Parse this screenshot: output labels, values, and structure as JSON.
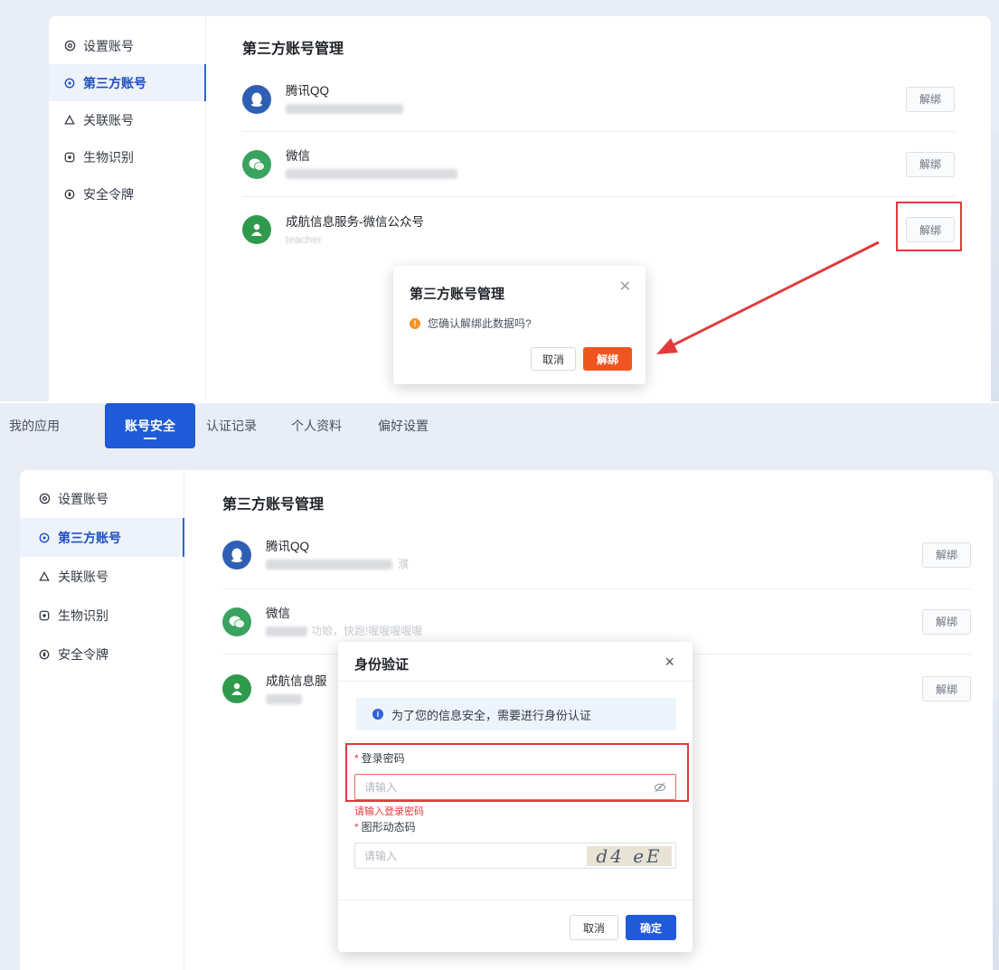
{
  "sidebar": {
    "items": [
      {
        "label": "设置账号",
        "icon": "gear-icon"
      },
      {
        "label": "第三方账号",
        "icon": "shield-icon",
        "active": true
      },
      {
        "label": "关联账号",
        "icon": "link-icon"
      },
      {
        "label": "生物识别",
        "icon": "face-scan-icon"
      },
      {
        "label": "安全令牌",
        "icon": "token-icon"
      }
    ]
  },
  "section_title": "第三方账号管理",
  "accounts": [
    {
      "name": "腾讯QQ",
      "icon": "qq-icon"
    },
    {
      "name": "微信",
      "icon": "wechat-icon"
    },
    {
      "name": "成航信息服务-微信公众号",
      "short_name": "成航信息服",
      "sub": "teacher",
      "icon": "user-icon"
    }
  ],
  "bottom_subs": {
    "qq_tail": "濮",
    "wx_tail": "功娘，快跑!喔喔喔喔喔"
  },
  "unbind_label": "解绑",
  "confirm_dialog": {
    "title": "第三方账号管理",
    "message": "您确认解绑此数据吗?",
    "cancel": "取消",
    "ok": "解绑"
  },
  "tabs": [
    "我的应用",
    "账号安全",
    "认证记录",
    "个人资料",
    "偏好设置"
  ],
  "auth_dialog": {
    "title": "身份验证",
    "tip": "为了您的信息安全，需要进行身份认证",
    "password_label": "登录密码",
    "password_placeholder": "请输入",
    "password_error": "请输入登录密码",
    "captcha_label": "图形动态码",
    "captcha_placeholder": "请输入",
    "captcha_text": "d4 eE",
    "cancel": "取消",
    "ok": "确定"
  },
  "colors": {
    "primary": "#1f5ad8",
    "danger": "#f0551f",
    "highlight": "#e23a3a"
  }
}
